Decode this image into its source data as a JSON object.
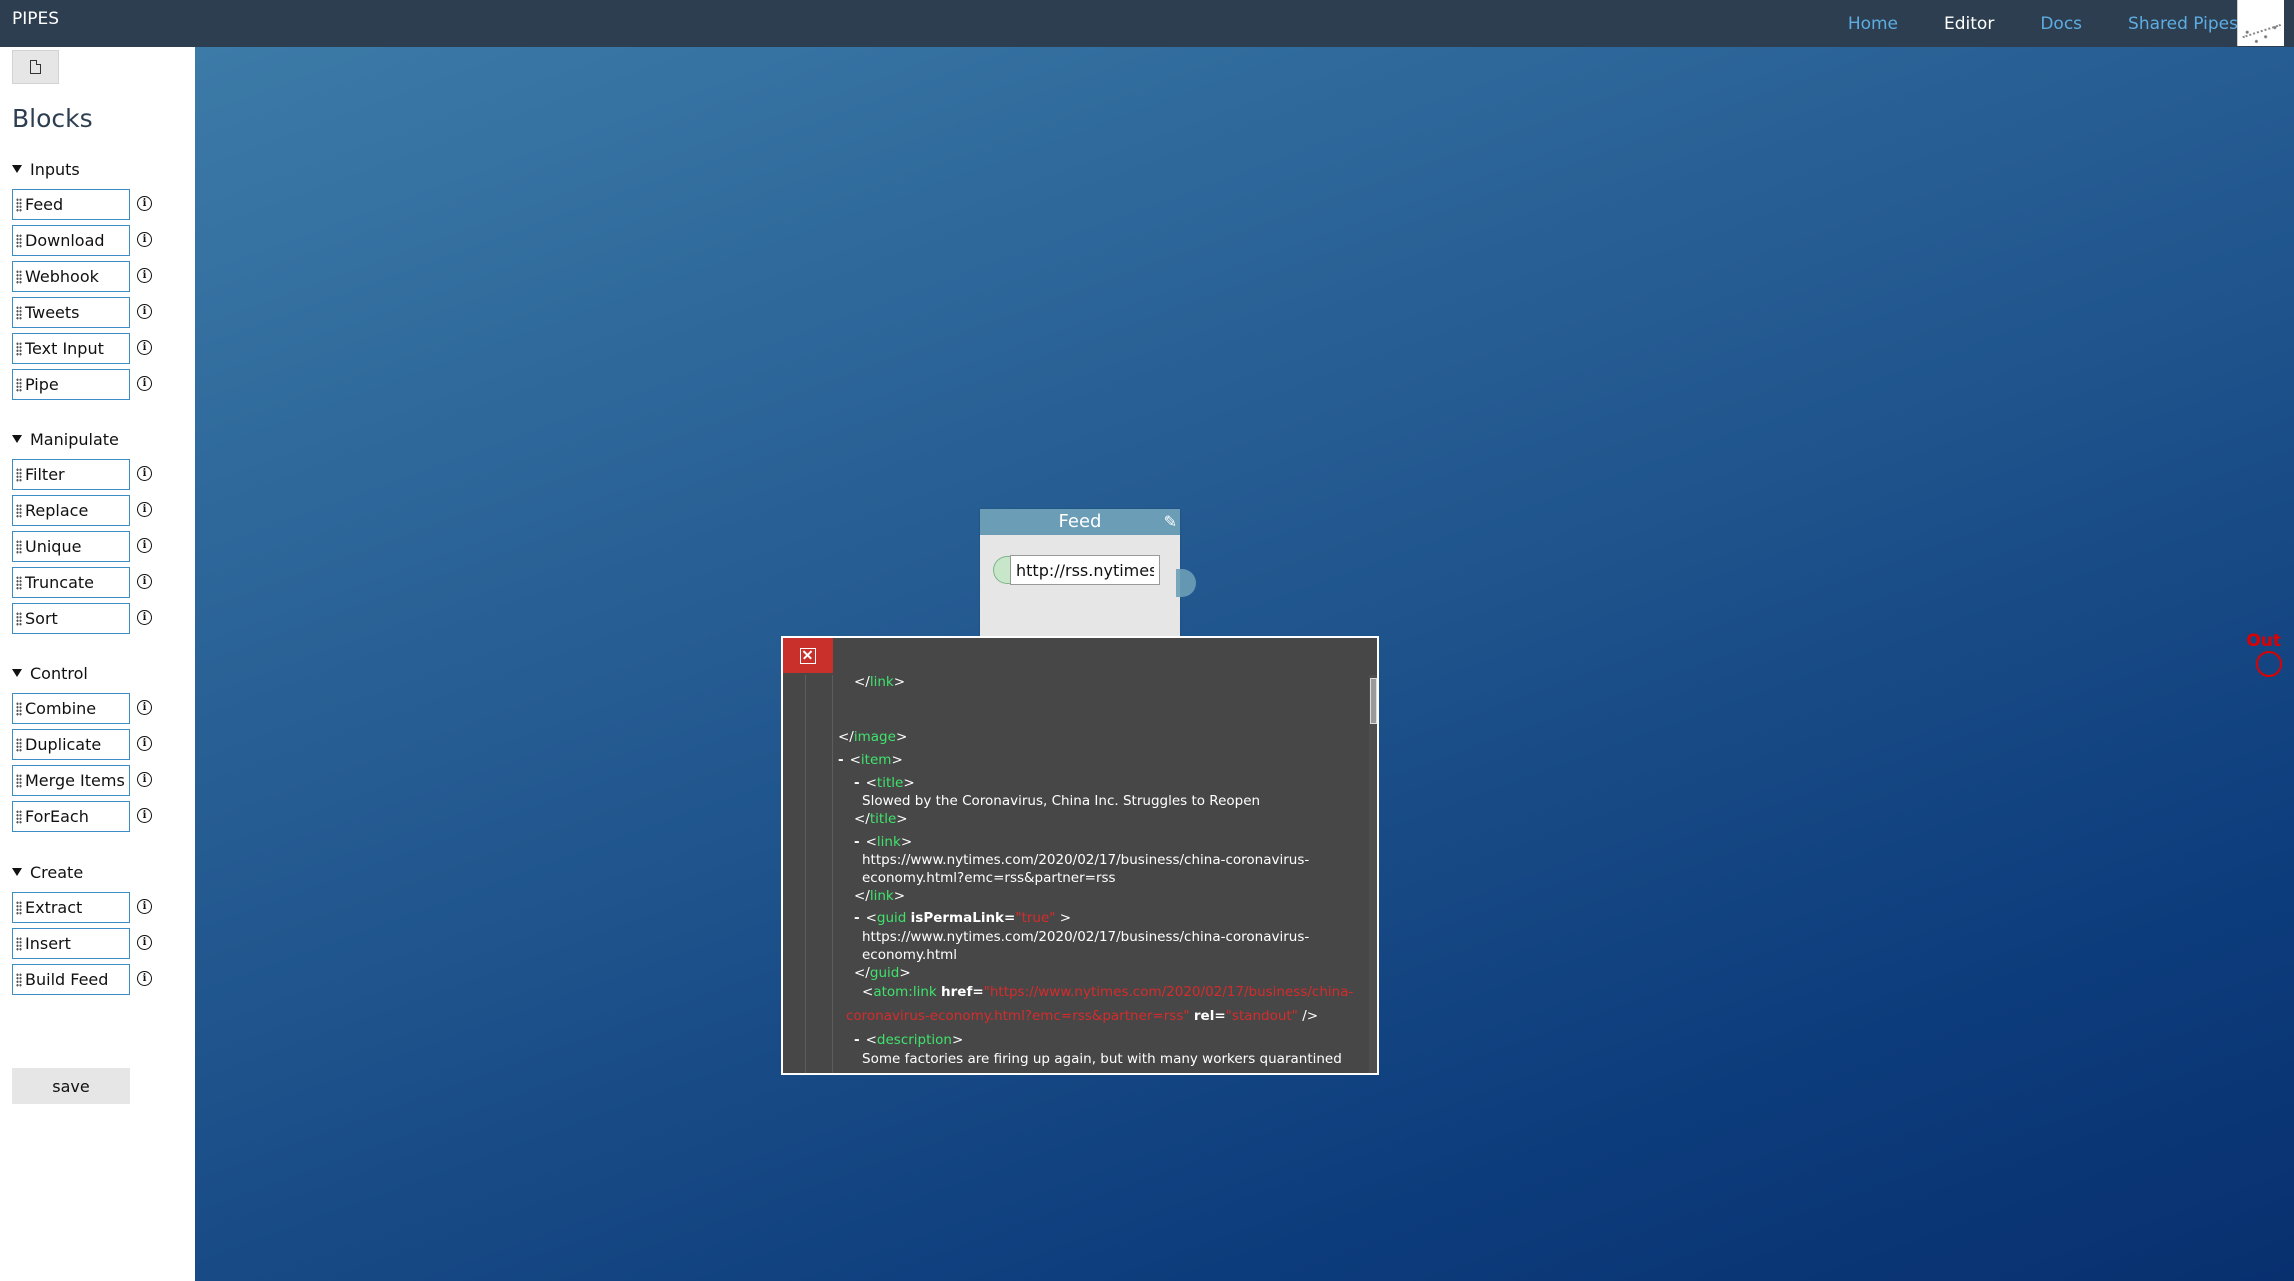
{
  "app": {
    "title": "PIPES"
  },
  "nav": {
    "items": [
      "Home",
      "Editor",
      "Docs",
      "Shared Pipes"
    ],
    "active": "Editor"
  },
  "sidebar": {
    "title": "Blocks",
    "groups": [
      {
        "name": "Inputs",
        "items": [
          "Feed",
          "Download",
          "Webhook",
          "Tweets",
          "Text Input",
          "Pipe"
        ]
      },
      {
        "name": "Manipulate",
        "items": [
          "Filter",
          "Replace",
          "Unique",
          "Truncate",
          "Sort"
        ]
      },
      {
        "name": "Control",
        "items": [
          "Combine",
          "Duplicate",
          "Merge Items",
          "ForEach"
        ]
      },
      {
        "name": "Create",
        "items": [
          "Extract",
          "Insert",
          "Build Feed"
        ]
      }
    ],
    "save_label": "save"
  },
  "canvas": {
    "feed_node": {
      "title": "Feed",
      "url_value": "http://rss.nytimes"
    },
    "output_label": "Out"
  },
  "preview": {
    "lines": [
      [
        "</",
        "link",
        ">"
      ],
      [
        "</",
        "image",
        ">"
      ],
      [
        "<",
        "item",
        ">"
      ],
      [
        "<",
        "title",
        ">"
      ],
      "Slowed by the Coronavirus, China Inc. Struggles to Reopen",
      [
        "</",
        "title",
        ">"
      ],
      [
        "<",
        "link",
        ">"
      ],
      "https://www.nytimes.com/2020/02/17/business/china-coronavirus-",
      "economy.html?emc=rss&partner=rss",
      [
        "</",
        "link",
        ">"
      ],
      {
        "tag": "guid",
        "attr": "isPermaLink",
        "value": "\"true\""
      },
      "https://www.nytimes.com/2020/02/17/business/china-coronavirus-",
      "economy.html",
      [
        "</",
        "guid",
        ">"
      ],
      {
        "tag": "atom:link",
        "attr": "href",
        "value": "\"https://www.nytimes.com/2020/02/17/business/china-"
      },
      {
        "value2": "coronavirus-economy.html?emc=rss&partner=rss\"",
        "attr2": "rel",
        "value3": "\"standout\""
      },
      [
        "<",
        "description",
        ">"
      ],
      "Some factories are firing up again, but with many workers quarantined"
    ]
  }
}
